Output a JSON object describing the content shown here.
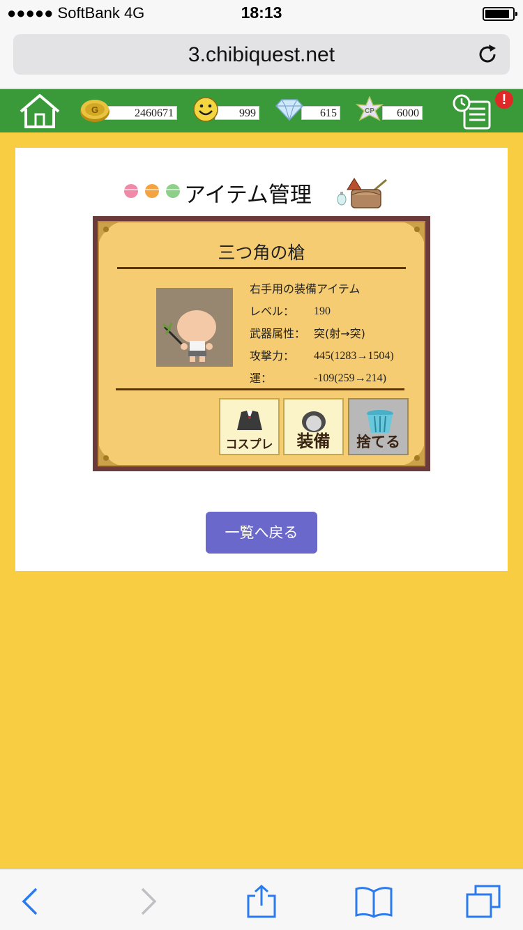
{
  "status_bar": {
    "carrier": "●●●●● SoftBank   4G",
    "time": "18:13"
  },
  "browser": {
    "url": "3.chibiquest.net"
  },
  "game_bar": {
    "gold": "2460671",
    "smile": "999",
    "diamond": "615",
    "cp": "6000",
    "alert": "!"
  },
  "page": {
    "title": "アイテム管理"
  },
  "item": {
    "name": "三つ角の槍",
    "description": "右手用の装備アイテム",
    "stats": [
      {
        "label": "レベル：",
        "value": "190"
      },
      {
        "label": "武器属性：",
        "value": "突(射→突)"
      },
      {
        "label": "攻撃力：",
        "value": "445(1283→1504)"
      },
      {
        "label": "運：",
        "value": "-109(259→214)"
      }
    ]
  },
  "actions": {
    "cosplay": "コスプレ",
    "equip": "装備",
    "discard": "捨てる"
  },
  "back_button": "一覧へ戻る",
  "colors": {
    "page_bg": "#f8cd42",
    "game_bar": "#3a9a3a",
    "card_bg": "#f6cc72",
    "card_border": "#6b3a3a",
    "back_button": "#6b68cc"
  },
  "icons": {
    "home": "home-icon",
    "gold": "gold-coin-icon",
    "smile": "smile-icon",
    "diamond": "diamond-icon",
    "cp": "cp-star-icon",
    "menu": "clock-list-icon",
    "reload": "reload-icon"
  }
}
